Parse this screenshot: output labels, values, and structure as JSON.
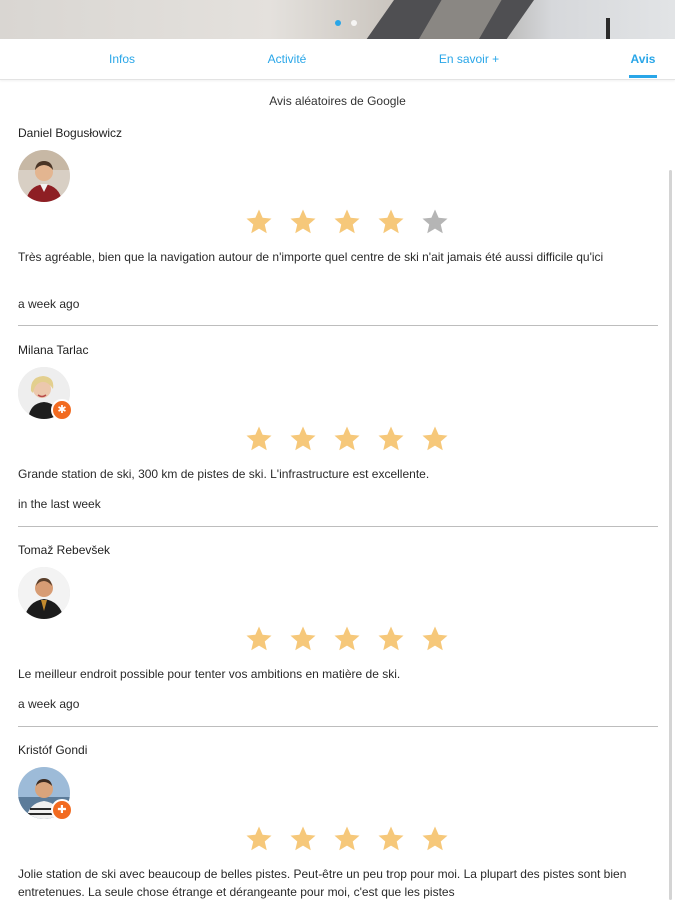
{
  "header": {
    "carousel_dots": 2,
    "active_dot_index": 0
  },
  "tabs": [
    {
      "label": "Infos",
      "active": false
    },
    {
      "label": "Activité",
      "active": false
    },
    {
      "label": "En savoir +",
      "active": false
    },
    {
      "label": "Avis",
      "active": true
    }
  ],
  "reviews_section": {
    "title": "Avis aléatoires de Google",
    "star_color": "#f6c87a",
    "star_empty_color": "#b5b5b5",
    "reviews": [
      {
        "name": "Daniel Bogusłowicz",
        "rating": 4,
        "max_rating": 5,
        "text": "Très agréable, bien que la navigation autour de n'importe quel centre de ski n'ait jamais été aussi difficile qu'ici",
        "time": "a week ago",
        "local_guide_badge": false
      },
      {
        "name": "Milana Tarlac",
        "rating": 5,
        "max_rating": 5,
        "text": "Grande station de ski, 300 km de pistes de ski. L'infrastructure est excellente.",
        "time": "in the last week",
        "local_guide_badge": true
      },
      {
        "name": "Tomaž Rebevšek",
        "rating": 5,
        "max_rating": 5,
        "text": "Le meilleur endroit possible pour tenter vos ambitions en matière de ski.",
        "time": "a week ago",
        "local_guide_badge": false
      },
      {
        "name": "Kristóf Gondi",
        "rating": 5,
        "max_rating": 5,
        "text": "Jolie station de ski avec beaucoup de belles pistes. Peut-être un peu trop pour moi. La plupart des pistes sont bien entretenues. La seule chose étrange et dérangeante pour moi, c'est que les pistes",
        "time": "",
        "local_guide_badge": true
      }
    ]
  }
}
